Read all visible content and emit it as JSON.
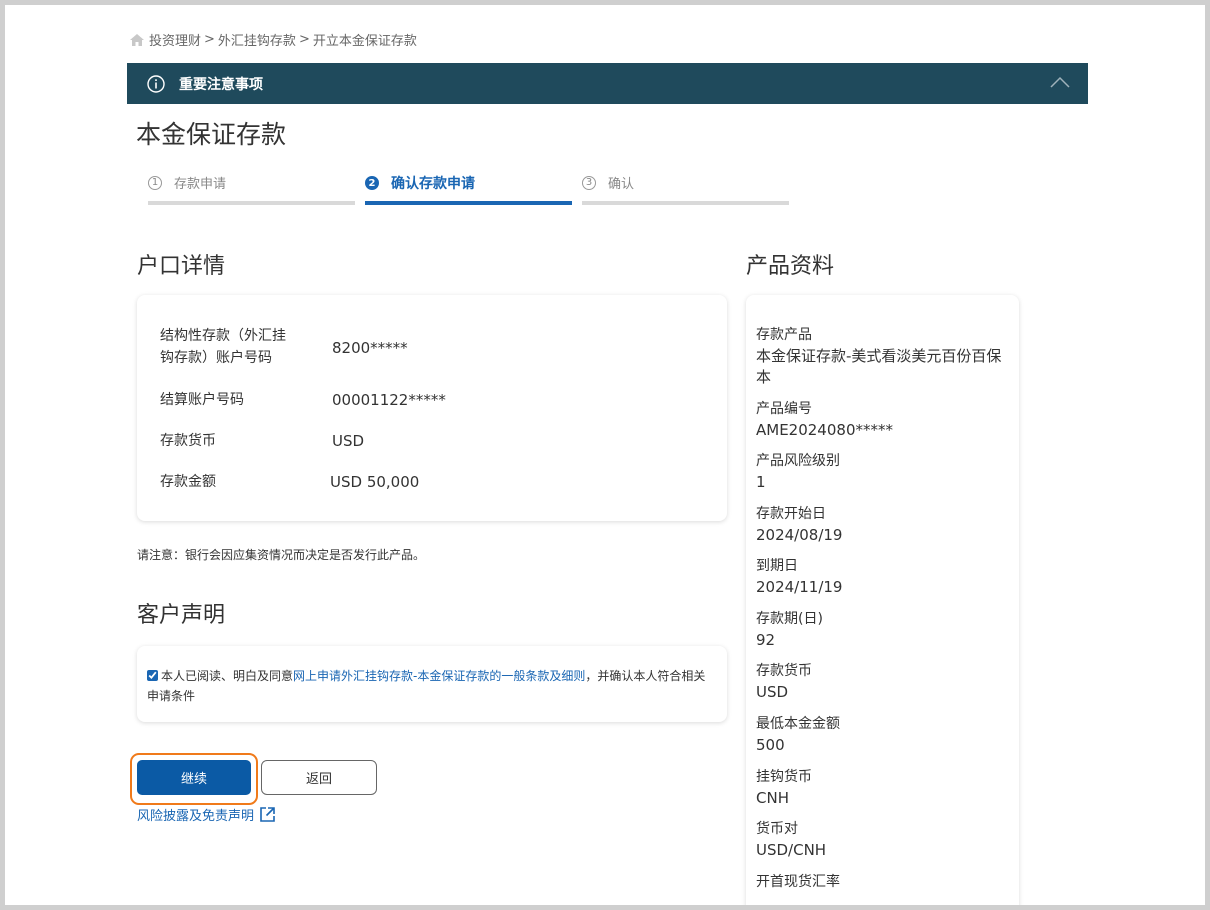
{
  "breadcrumb": {
    "items": [
      "投资理财",
      "外汇挂钩存款",
      "开立本金保证存款"
    ],
    "sep": ">"
  },
  "notice": {
    "title": "重要注意事项"
  },
  "page": {
    "title": "本金保证存款"
  },
  "steps": [
    {
      "num": "1",
      "label": "存款申请"
    },
    {
      "num": "2",
      "label": "确认存款申请"
    },
    {
      "num": "3",
      "label": "确认"
    }
  ],
  "account": {
    "title": "户口详情",
    "rows": [
      {
        "label": "结构性存款（外汇挂钩存款）账户号码",
        "value": "8200*****"
      },
      {
        "label": "结算账户号码",
        "value": "00001122*****"
      },
      {
        "label": "存款货币",
        "value": "USD"
      },
      {
        "label": "存款金额",
        "value": "USD 50,000"
      }
    ]
  },
  "note": "请注意：银行会因应集资情况而决定是否发行此产品。",
  "declaration": {
    "title": "客户声明",
    "text_before": "本人已阅读、明白及同意",
    "link_text": "网上申请外汇挂钩存款-本金保证存款的一般条款及细则",
    "text_after": "，并确认本人符合相关申请条件",
    "checked": true
  },
  "buttons": {
    "continue": "继续",
    "back": "返回"
  },
  "risk_link": "风险披露及免责声明",
  "product": {
    "title": "产品资料",
    "items": [
      {
        "label": "存款产品",
        "value": "本金保证存款-美式看淡美元百份百保本"
      },
      {
        "label": "产品编号",
        "value": "AME2024080*****"
      },
      {
        "label": "产品风险级别",
        "value": "1"
      },
      {
        "label": "存款开始日",
        "value": "2024/08/19"
      },
      {
        "label": "到期日",
        "value": "2024/11/19"
      },
      {
        "label": "存款期(日)",
        "value": "92"
      },
      {
        "label": "存款货币",
        "value": "USD"
      },
      {
        "label": "最低本金金额",
        "value": "500"
      },
      {
        "label": "挂钩货币",
        "value": "CNH"
      },
      {
        "label": "货币对",
        "value": "USD/CNH"
      },
      {
        "label": "开首现货汇率",
        "value": ""
      }
    ]
  },
  "colors": {
    "accent": "#1a66b3",
    "notice_bg": "#1f4a5c",
    "continue_bg": "#0b5aa5",
    "highlight": "#f07a1a"
  }
}
